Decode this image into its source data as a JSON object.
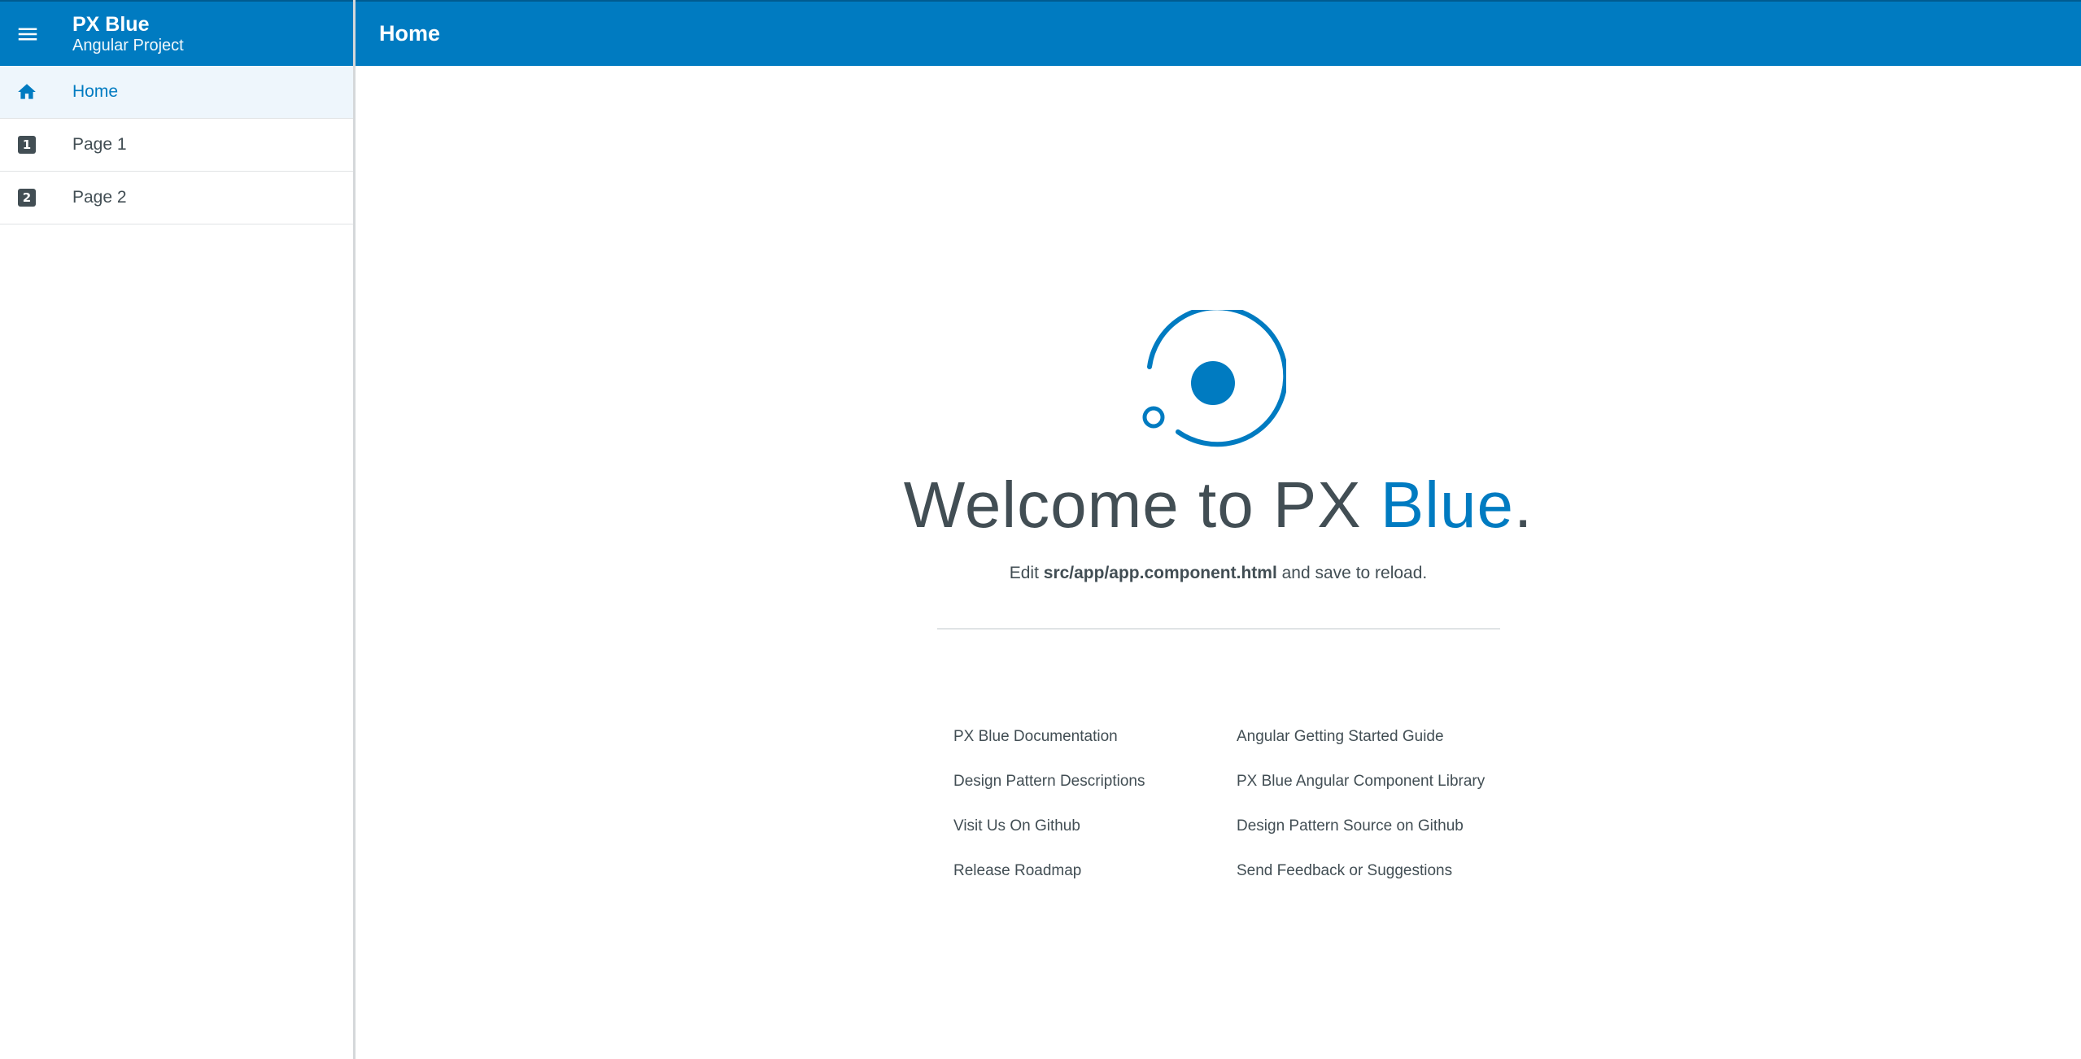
{
  "app": {
    "title": "PX Blue",
    "subtitle": "Angular Project"
  },
  "sidebar": {
    "items": [
      {
        "label": "Home",
        "icon": "home-icon",
        "active": true
      },
      {
        "label": "Page 1",
        "icon": "looks-one-icon",
        "glyph": "1"
      },
      {
        "label": "Page 2",
        "icon": "looks-two-icon",
        "glyph": "2"
      }
    ]
  },
  "toolbar": {
    "title": "Home",
    "menu_icon": "menu-icon"
  },
  "main": {
    "logo_icon": "px-blue-logo",
    "welcome_prefix": "Welcome to PX ",
    "welcome_blue": "Blue",
    "welcome_suffix": ".",
    "edit_prefix": "Edit ",
    "edit_path": "src/app/app.component.html",
    "edit_suffix": " and save to reload.",
    "links_left": [
      "PX Blue Documentation",
      "Design Pattern Descriptions",
      "Visit Us On Github",
      "Release Roadmap"
    ],
    "links_right": [
      "Angular Getting Started Guide",
      "PX Blue Angular Component Library",
      "Design Pattern Source on Github",
      "Send Feedback or Suggestions"
    ]
  },
  "colors": {
    "primary": "#007bc1",
    "text": "#424e54",
    "active_bg": "#eef6fc"
  }
}
